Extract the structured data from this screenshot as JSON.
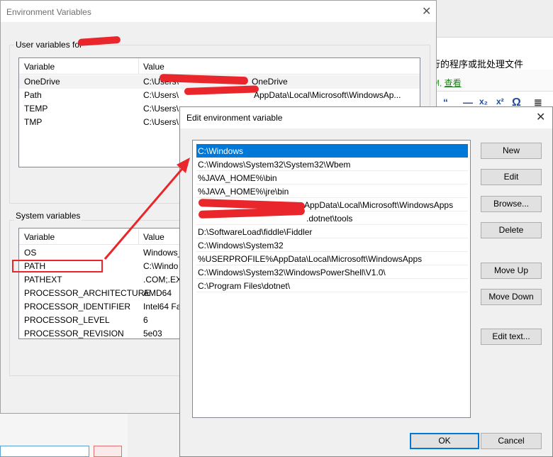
{
  "background_window": {
    "text_line": "行的程序或批处理文件",
    "link_text": "查看",
    "tool_glyphs": [
      "“",
      "—",
      "x₂",
      "x²",
      "Ω",
      "≣"
    ]
  },
  "env_window": {
    "title": "Environment Variables",
    "user_group_label": "User variables for",
    "system_group_label": "System variables",
    "columns": [
      "Variable",
      "Value"
    ],
    "user_rows": [
      {
        "variable": "OneDrive",
        "value": "C:\\Users\\",
        "value_tail": "OneDrive"
      },
      {
        "variable": "Path",
        "value": "C:\\Users\\",
        "value_tail": "AppData\\Local\\Microsoft\\WindowsAp..."
      },
      {
        "variable": "TEMP",
        "value": "C:\\Users\\"
      },
      {
        "variable": "TMP",
        "value": "C:\\Users\\"
      }
    ],
    "system_rows": [
      {
        "variable": "OS",
        "value": "Windows_"
      },
      {
        "variable": "PATH",
        "value": "C:\\Windo"
      },
      {
        "variable": "PATHEXT",
        "value": ".COM;.EX"
      },
      {
        "variable": "PROCESSOR_ARCHITECTURE",
        "value": "AMD64"
      },
      {
        "variable": "PROCESSOR_IDENTIFIER",
        "value": "Intel64 Fa"
      },
      {
        "variable": "PROCESSOR_LEVEL",
        "value": "6"
      },
      {
        "variable": "PROCESSOR_REVISION",
        "value": "5e03"
      }
    ]
  },
  "edit_dialog": {
    "title": "Edit environment variable",
    "paths": [
      "C:\\Windows",
      "C:\\Windows\\System32\\System32\\Wbem",
      "%JAVA_HOME%\\bin",
      "%JAVA_HOME%\\jre\\bin",
      "AppData\\Local\\Microsoft\\WindowsApps",
      ".dotnet\\tools",
      "D:\\SoftwareLoad\\fiddle\\Fiddler",
      "C:\\Windows\\System32",
      "%USERPROFILE%AppData\\Local\\Microsoft\\WindowsApps",
      "C:\\Windows\\System32\\WindowsPowerShell\\V1.0\\",
      "C:\\Program Files\\dotnet\\"
    ],
    "buttons": {
      "new": "New",
      "edit": "Edit",
      "browse": "Browse...",
      "delete": "Delete",
      "move_up": "Move Up",
      "move_down": "Move Down",
      "edit_text": "Edit text...",
      "ok": "OK",
      "cancel": "Cancel"
    }
  },
  "colors": {
    "selection": "#0078d7",
    "annotation_red": "#e8262b",
    "link_green": "#1a7f1a"
  }
}
